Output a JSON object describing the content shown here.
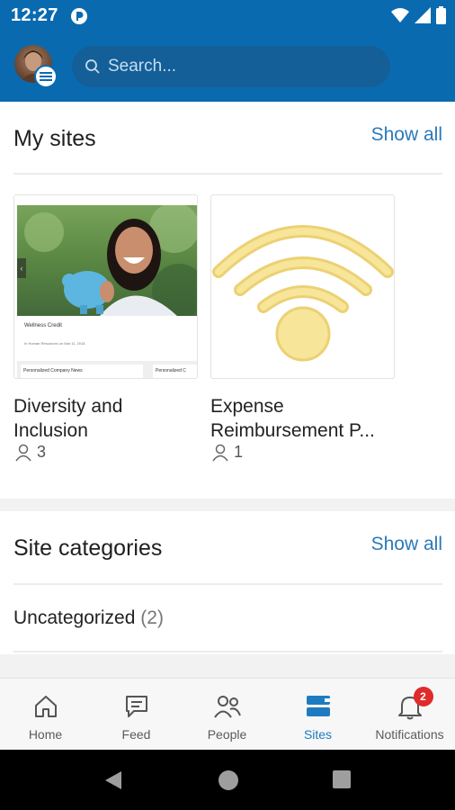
{
  "status_bar": {
    "time": "12:27",
    "icons": [
      "app-notification-icon",
      "wifi-icon",
      "signal-icon",
      "battery-icon"
    ]
  },
  "header": {
    "search": {
      "placeholder": "Search..."
    },
    "avatar": "user-avatar"
  },
  "my_sites": {
    "title": "My sites",
    "show_all_label": "Show all",
    "sites": [
      {
        "name": "Diversity and Inclusion",
        "members": "3",
        "thumbnail": {
          "headline": "Wellness Credit",
          "byline": "In Human Resources on Mar 11, 2018",
          "tile_1": "Personalized Company News",
          "tile_2": "Personalized C"
        }
      },
      {
        "name": "Expense Reimbursement P...",
        "members": "1",
        "thumbnail_icon": "wifi-logo-icon"
      }
    ]
  },
  "site_categories": {
    "title": "Site categories",
    "show_all_label": "Show all",
    "items": [
      {
        "label": "Uncategorized",
        "count": "(2)"
      }
    ]
  },
  "bottom_nav": {
    "items": [
      {
        "label": "Home",
        "icon": "home-icon",
        "active": false
      },
      {
        "label": "Feed",
        "icon": "feed-icon",
        "active": false
      },
      {
        "label": "People",
        "icon": "people-icon",
        "active": false
      },
      {
        "label": "Sites",
        "icon": "sites-icon",
        "active": true
      },
      {
        "label": "Notifications",
        "icon": "bell-icon",
        "active": false,
        "badge": "2"
      }
    ]
  },
  "colors": {
    "brand_blue": "#0a6ab0",
    "link_blue": "#2a7ab8",
    "active_tab": "#1f7bc0",
    "badge_red": "#e02b2b",
    "wifi_yellow": "#f5e08a"
  }
}
